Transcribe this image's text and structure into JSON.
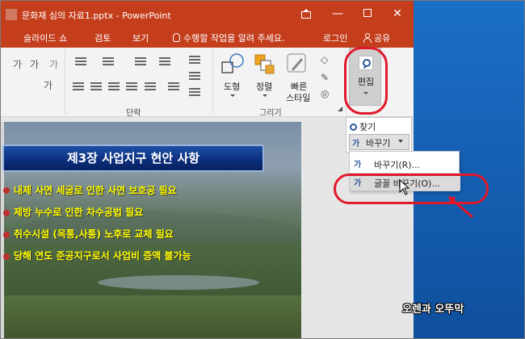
{
  "window": {
    "title": "문화재 심의 자료1.pptx - PowerPoint",
    "controls": {
      "minimize": "—",
      "close": "✕"
    }
  },
  "tabs": {
    "slideshow": "슬라이드 쇼",
    "review": "검토",
    "view": "보기",
    "tell_me": "수행할 작업을 알려 주세요.",
    "login": "로그인",
    "share": "공유"
  },
  "ribbon": {
    "paragraph_label": "단락",
    "drawing_label": "그리기",
    "shapes_label": "도형",
    "arrange_label": "정렬",
    "quick_styles_label_1": "빠른",
    "quick_styles_label_2": "스타일",
    "edit_label": "편집",
    "font_glyphs": [
      "가",
      "가",
      "가"
    ]
  },
  "slide": {
    "title": "제3장 사업지구 현안 사항",
    "bullets": [
      "내제 사면 세굴로 인한 사면 보호공 필요",
      "제방 누수로 인한 차수공법 필요",
      "취수시설 (목통,사통) 노후로  교체 필요",
      "당해 연도 준공지구로서 사업비 증액 불가능"
    ]
  },
  "edit_dropdown": {
    "find": "찾기",
    "replace": "바꾸기",
    "replace_icon": "가",
    "menu": {
      "replace": "바꾸기(R)...",
      "replace_font": "글꼴 바꾸기(O)..."
    }
  },
  "annotation_color": "#e0182a",
  "title_bar_color": "#c43e1c",
  "watermark": "오렌과 오뚜막"
}
